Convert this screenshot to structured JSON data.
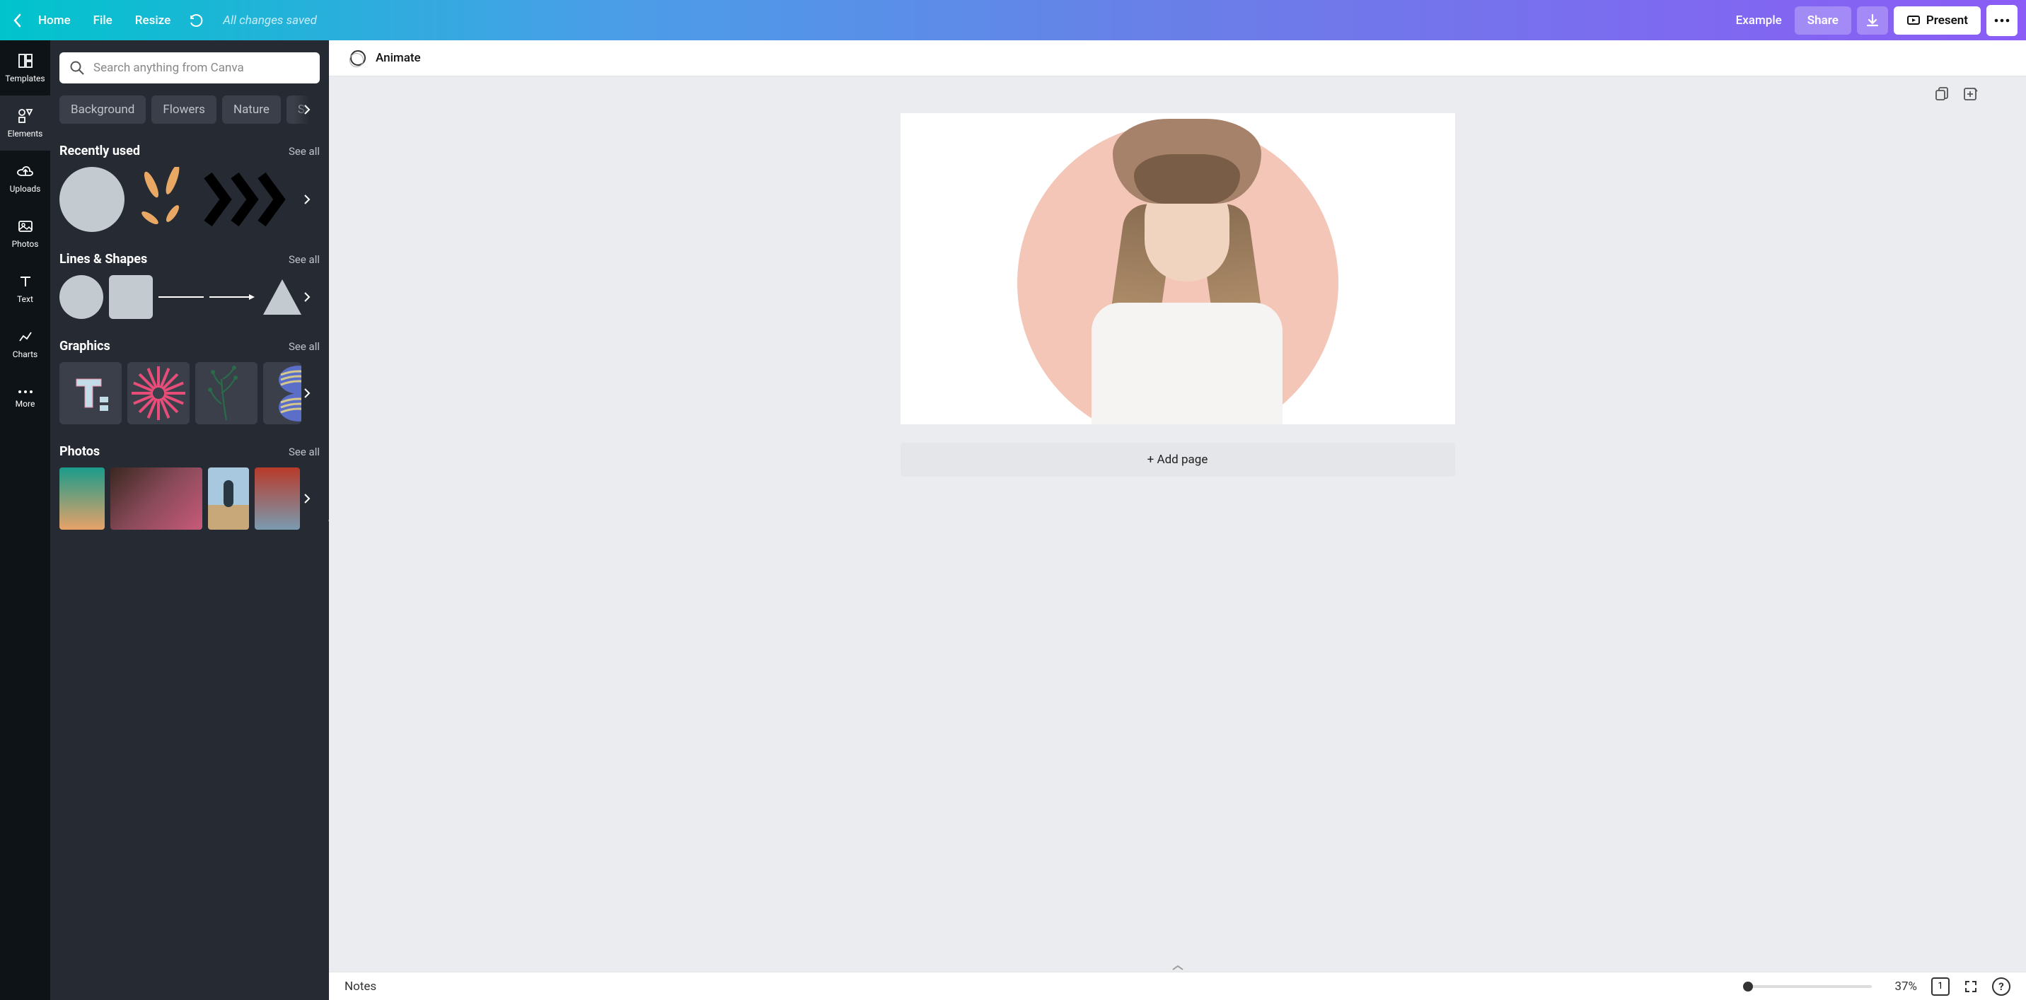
{
  "topbar": {
    "home": "Home",
    "file": "File",
    "resize": "Resize",
    "status": "All changes saved",
    "design_name": "Example",
    "share": "Share",
    "present": "Present"
  },
  "rail": {
    "templates": "Templates",
    "elements": "Elements",
    "uploads": "Uploads",
    "photos": "Photos",
    "text": "Text",
    "charts": "Charts",
    "more": "More"
  },
  "search": {
    "placeholder": "Search anything from Canva"
  },
  "chips": [
    "Background",
    "Flowers",
    "Nature",
    "Summer"
  ],
  "sections": {
    "recent": {
      "title": "Recently used",
      "see_all": "See all"
    },
    "lines": {
      "title": "Lines & Shapes",
      "see_all": "See all"
    },
    "graphics": {
      "title": "Graphics",
      "see_all": "See all"
    },
    "photos": {
      "title": "Photos",
      "see_all": "See all"
    }
  },
  "canvas": {
    "animate": "Animate",
    "add_page": "+ Add page"
  },
  "bottom": {
    "notes": "Notes",
    "zoom_pct": "37%",
    "page_count": "1"
  }
}
